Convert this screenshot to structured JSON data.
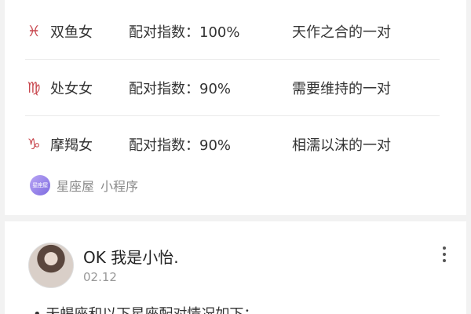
{
  "matches": [
    {
      "icon": "pisces-icon",
      "symbol": "♓",
      "sign": "双鱼女",
      "score": "配对指数：100%",
      "desc": "天作之合的一对"
    },
    {
      "icon": "virgo-icon",
      "symbol": "♍",
      "sign": "处女女",
      "score": "配对指数：90%",
      "desc": "需要维持的一对"
    },
    {
      "icon": "capricorn-icon",
      "symbol": "♑",
      "sign": "摩羯女",
      "score": "配对指数：90%",
      "desc": "相濡以沫的一对"
    }
  ],
  "mini_program": {
    "logo_text": "星座屋",
    "name": "星座屋",
    "tag": "小程序"
  },
  "post": {
    "username": "OK 我是小怡.",
    "date": "02.12",
    "text": "• 天蝎座和以下星座配对情况如下："
  },
  "colors": {
    "accent": "#c8474e",
    "background": "#f2f2f2"
  }
}
